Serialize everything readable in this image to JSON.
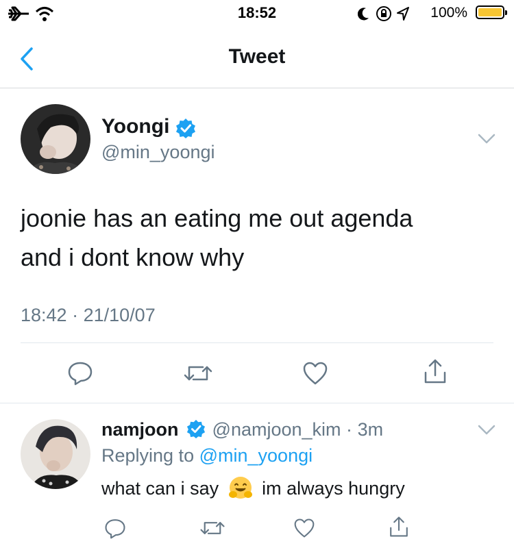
{
  "status_bar": {
    "time": "18:52",
    "battery_percent": "100%",
    "battery_level": 1.0
  },
  "nav": {
    "title": "Tweet"
  },
  "tweet": {
    "author_name": "Yoongi",
    "author_handle": "@min_yoongi",
    "text_line1": "joonie has an eating me out agenda",
    "text_line2": "and i dont know why",
    "timestamp": "18:42",
    "separator": "·",
    "date": "21/10/07"
  },
  "reply": {
    "author_name": "namjoon",
    "author_handle": "@namjoon_kim",
    "separator": "·",
    "age": "3m",
    "replying_label": "Replying to",
    "replying_handle": "@min_yoongi",
    "text_before": "what can i say",
    "text_after": "im always hungry"
  },
  "colors": {
    "accent": "#1da1f2",
    "muted": "#657786",
    "divider": "#e1e8ed"
  }
}
